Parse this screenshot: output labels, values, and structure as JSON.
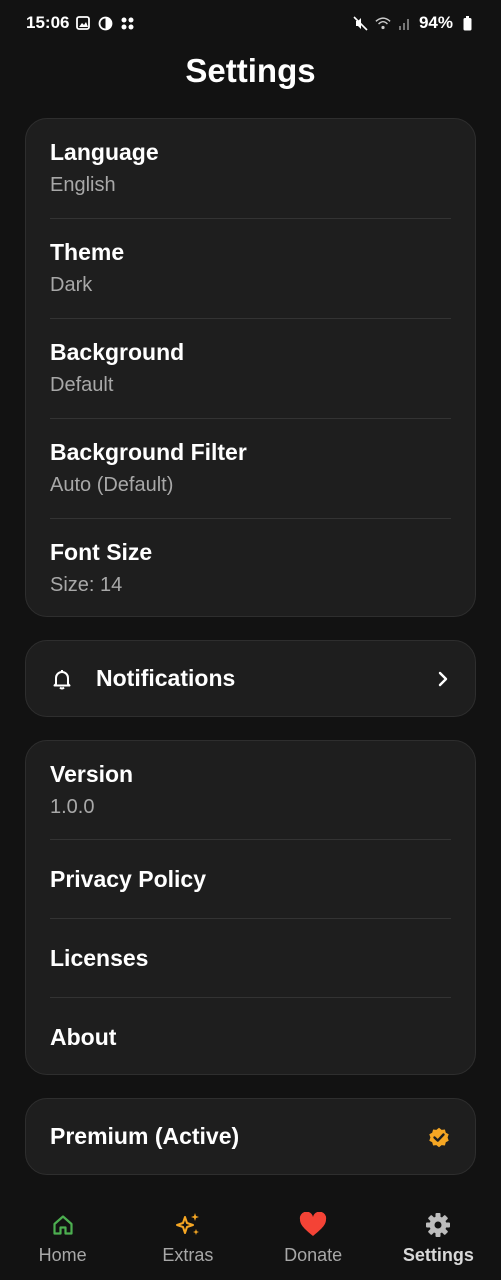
{
  "status_bar": {
    "time": "15:06",
    "battery": "94%"
  },
  "page_title": "Settings",
  "settings": [
    {
      "title": "Language",
      "value": "English"
    },
    {
      "title": "Theme",
      "value": "Dark"
    },
    {
      "title": "Background",
      "value": "Default"
    },
    {
      "title": "Background Filter",
      "value": "Auto (Default)"
    },
    {
      "title": "Font Size",
      "value": "Size: 14"
    }
  ],
  "notifications": {
    "label": "Notifications",
    "icon": "bell-icon"
  },
  "about": {
    "version_title": "Version",
    "version_value": "1.0.0",
    "links": [
      "Privacy Policy",
      "Licenses",
      "About"
    ]
  },
  "premium": {
    "label": "Premium (Active)",
    "icon": "verified-badge-icon",
    "color": "#f5a623"
  },
  "bottom_nav": [
    {
      "label": "Home",
      "icon": "home-icon",
      "color": "#4caf50"
    },
    {
      "label": "Extras",
      "icon": "sparkle-icon",
      "color": "#f5a623"
    },
    {
      "label": "Donate",
      "icon": "heart-icon",
      "color": "#f44336"
    },
    {
      "label": "Settings",
      "icon": "gear-icon",
      "color": "#bdbdbd",
      "active": true
    }
  ],
  "colors": {
    "background": "#121212",
    "card": "#1e1e1e",
    "text_secondary": "#a8a8a8"
  }
}
